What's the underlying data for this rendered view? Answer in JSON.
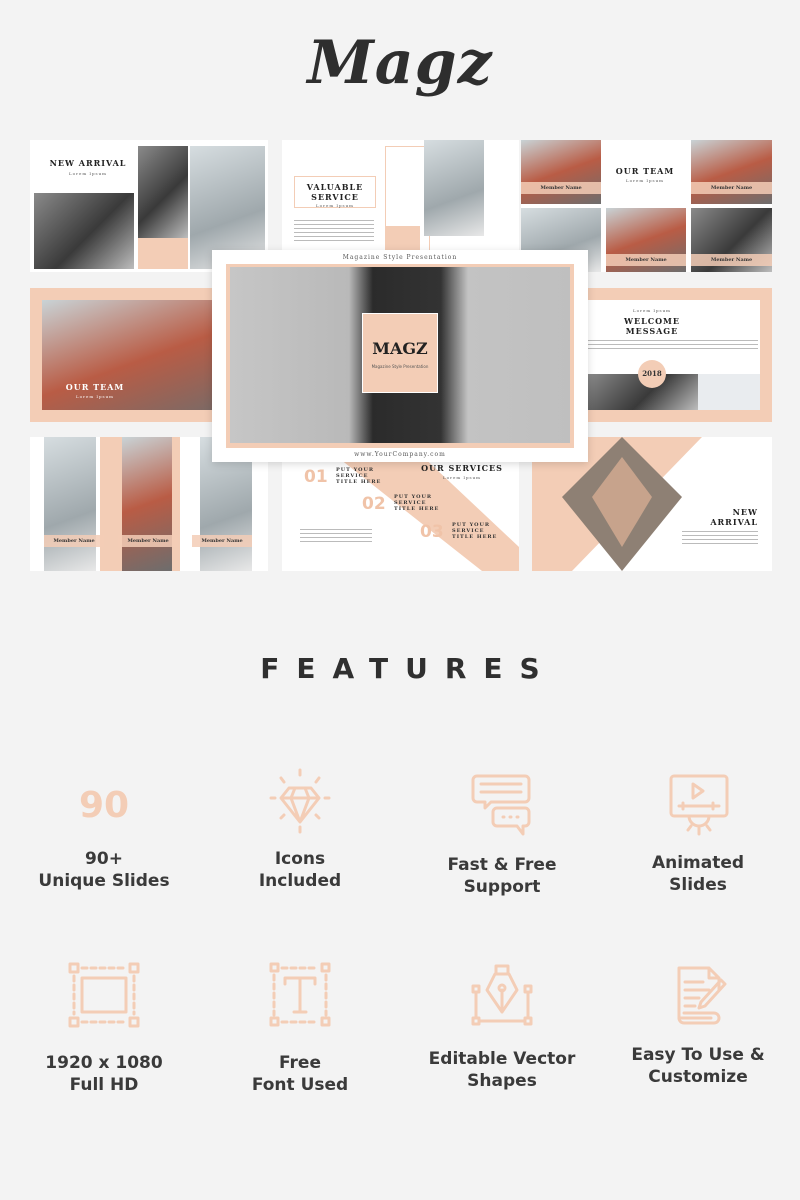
{
  "brand": {
    "logo": "Magz",
    "accent": "#f3cdb6",
    "background": "#f3f3f3"
  },
  "slides": {
    "new_arrival": {
      "title": "NEW ARRIVAL",
      "subtitle": "Lorem Ipsum"
    },
    "valuable_service": {
      "title": "VALUABLE SERVICE",
      "subtitle": "Lorem Ipsum"
    },
    "our_team_top": {
      "title": "OUR TEAM",
      "subtitle": "Lorem Ipsum",
      "members": [
        "Member Name",
        "Member Name",
        "Member Name",
        "Member Name"
      ]
    },
    "our_team_left": {
      "title": "OUR TEAM",
      "subtitle": "Lorem Ipsum"
    },
    "cover": {
      "header": "Magazine Style Presentation",
      "title": "MAGZ",
      "subtitle": "Magazine Style Presentation",
      "footer": "www.YourCompany.com"
    },
    "welcome": {
      "kicker": "Lorem Ipsum",
      "title": "WELCOME MESSAGE",
      "year": "2018"
    },
    "members_row": {
      "members": [
        "Member Name",
        "Member Name",
        "Member Name"
      ]
    },
    "services": {
      "title": "OUR SERVICES",
      "subtitle": "Lorem Ipsum",
      "items": [
        {
          "num": "01",
          "label": "PUT YOUR SERVICE TITLE HERE"
        },
        {
          "num": "02",
          "label": "PUT YOUR SERVICE TITLE HERE"
        },
        {
          "num": "03",
          "label": "PUT YOUR SERVICE TITLE HERE"
        }
      ]
    },
    "new_arrival_2": {
      "title": "NEW ARRIVAL"
    }
  },
  "features": {
    "title": "FEATURES",
    "items": [
      {
        "icon": "number-90-icon",
        "icon_text": "90",
        "line1": "90+",
        "line2": "Unique Slides"
      },
      {
        "icon": "diamond-icon",
        "line1": "Icons",
        "line2": "Included"
      },
      {
        "icon": "chat-bubbles-icon",
        "line1": "Fast & Free",
        "line2": "Support"
      },
      {
        "icon": "video-gear-icon",
        "line1": "Animated",
        "line2": "Slides"
      },
      {
        "icon": "resize-frame-icon",
        "line1": "1920 x 1080",
        "line2": "Full HD"
      },
      {
        "icon": "text-frame-icon",
        "line1": "Free",
        "line2": "Font Used"
      },
      {
        "icon": "pen-nib-vector-icon",
        "line1": "Editable Vector",
        "line2": "Shapes"
      },
      {
        "icon": "document-edit-icon",
        "line1": "Easy To Use &",
        "line2": "Customize"
      }
    ]
  }
}
